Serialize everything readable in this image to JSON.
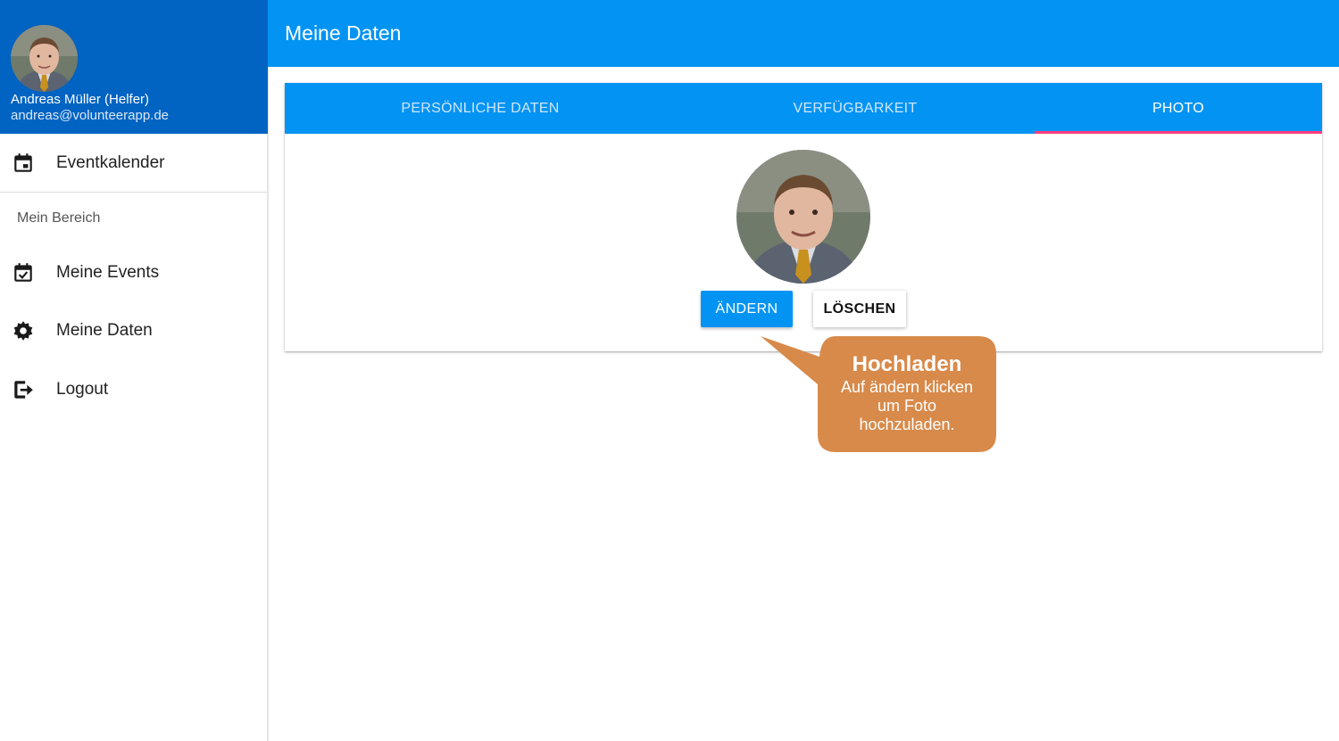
{
  "profile": {
    "name": "Andreas Müller (Helfer)",
    "email": "andreas@volunteerapp.de"
  },
  "sidebar": {
    "items": [
      {
        "label": "Eventkalender",
        "icon": "calendar-icon"
      },
      {
        "label": "Meine Events",
        "icon": "calendar-check-icon"
      },
      {
        "label": "Meine Daten",
        "icon": "gear-icon"
      },
      {
        "label": "Logout",
        "icon": "logout-icon"
      }
    ],
    "section_header": "Mein Bereich"
  },
  "appbar": {
    "title": "Meine Daten"
  },
  "tabs": [
    {
      "label": "PERSÖNLICHE DATEN",
      "active": false
    },
    {
      "label": "VERFÜGBARKEIT",
      "active": false
    },
    {
      "label": "PHOTO",
      "active": true
    }
  ],
  "photo": {
    "change_label": "ÄNDERN",
    "delete_label": "LÖSCHEN"
  },
  "callout": {
    "title": "Hochladen",
    "body": "Auf ändern klicken\num Foto\nhochzuladen."
  },
  "colors": {
    "header_dark": "#0163c2",
    "primary": "#0394f3",
    "tab_indicator": "#ff3d7f",
    "callout": "#d88a4a"
  }
}
